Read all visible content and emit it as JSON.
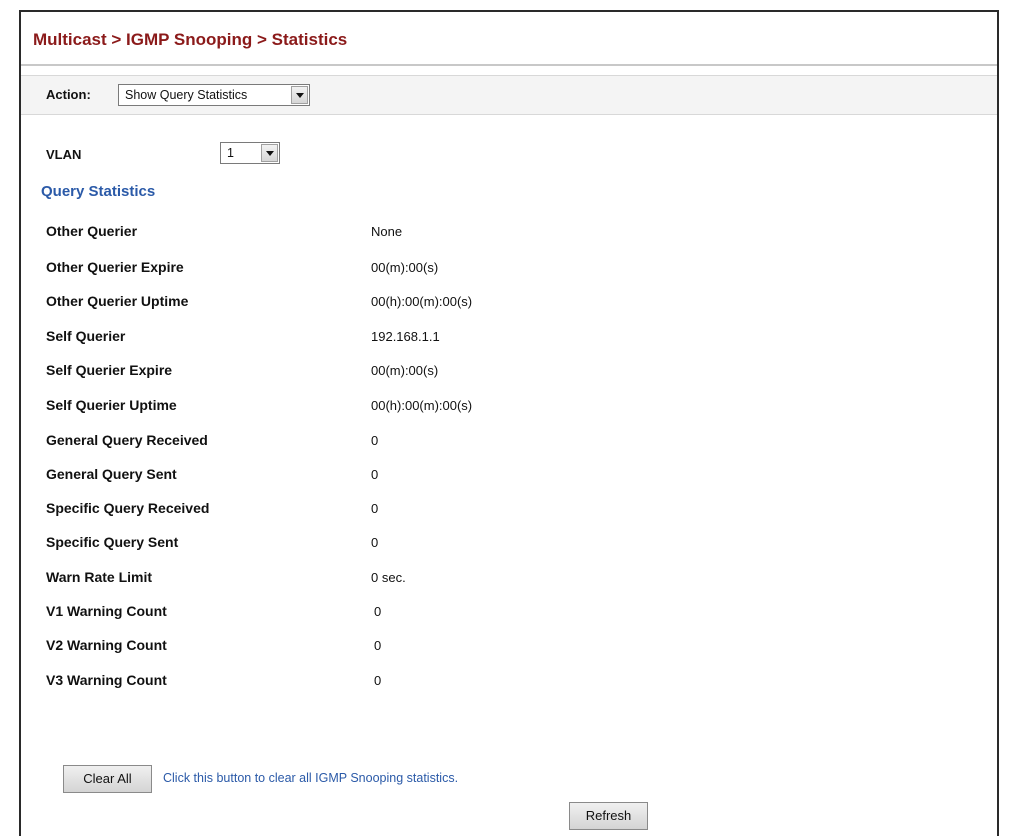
{
  "breadcrumb": "Multicast > IGMP Snooping > Statistics",
  "action": {
    "label": "Action:",
    "selected": "Show Query Statistics"
  },
  "vlan": {
    "label": "VLAN",
    "selected": "1"
  },
  "section_title": "Query Statistics",
  "stats": [
    {
      "label": "Other Querier",
      "value": "None"
    },
    {
      "label": "Other Querier Expire",
      "value": "00(m):00(s)"
    },
    {
      "label": "Other Querier Uptime",
      "value": "00(h):00(m):00(s)"
    },
    {
      "label": "Self Querier",
      "value": "192.168.1.1"
    },
    {
      "label": "Self Querier Expire",
      "value": "00(m):00(s)"
    },
    {
      "label": "Self Querier Uptime",
      "value": "00(h):00(m):00(s)"
    },
    {
      "label": "General Query Received",
      "value": "0"
    },
    {
      "label": "General Query Sent",
      "value": "0"
    },
    {
      "label": "Specific Query Received",
      "value": "0"
    },
    {
      "label": "Specific Query Sent",
      "value": "0"
    },
    {
      "label": "Warn Rate Limit",
      "value": "0 sec."
    },
    {
      "label": "V1 Warning Count",
      "value": "0"
    },
    {
      "label": "V2 Warning Count",
      "value": "0"
    },
    {
      "label": "V3 Warning Count",
      "value": "0"
    }
  ],
  "clear_button": "Clear All",
  "clear_hint": "Click this button to clear all IGMP Snooping statistics.",
  "refresh_button": "Refresh",
  "colors": {
    "breadcrumb": "#8b1a1a",
    "section_title": "#2b5aa8",
    "hint_text": "#2b5aa8"
  }
}
